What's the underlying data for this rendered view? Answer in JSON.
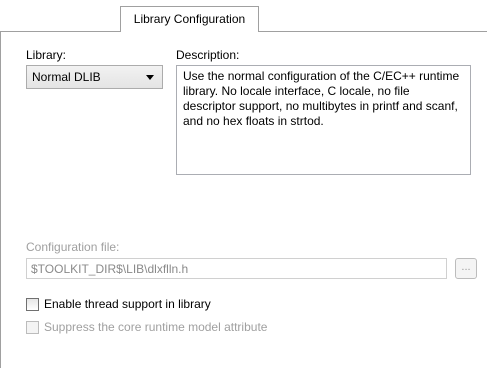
{
  "tab": {
    "label": "Library Configuration"
  },
  "library": {
    "label": "Library:",
    "selected": "Normal DLIB"
  },
  "description": {
    "label": "Description:",
    "text": "Use the normal configuration of the C/EC++ runtime library. No locale interface, C locale, no file descriptor support, no multibytes in printf and scanf, and no hex floats in strtod."
  },
  "config_file": {
    "label": "Configuration file:",
    "value": "$TOOLKIT_DIR$\\LIB\\dlxflln.h",
    "browse_label": "..."
  },
  "options": {
    "thread_support": {
      "label": "Enable thread support in library",
      "checked": false,
      "enabled": true
    },
    "suppress_runtime": {
      "label": "Suppress the core runtime model attribute",
      "checked": false,
      "enabled": false
    }
  }
}
